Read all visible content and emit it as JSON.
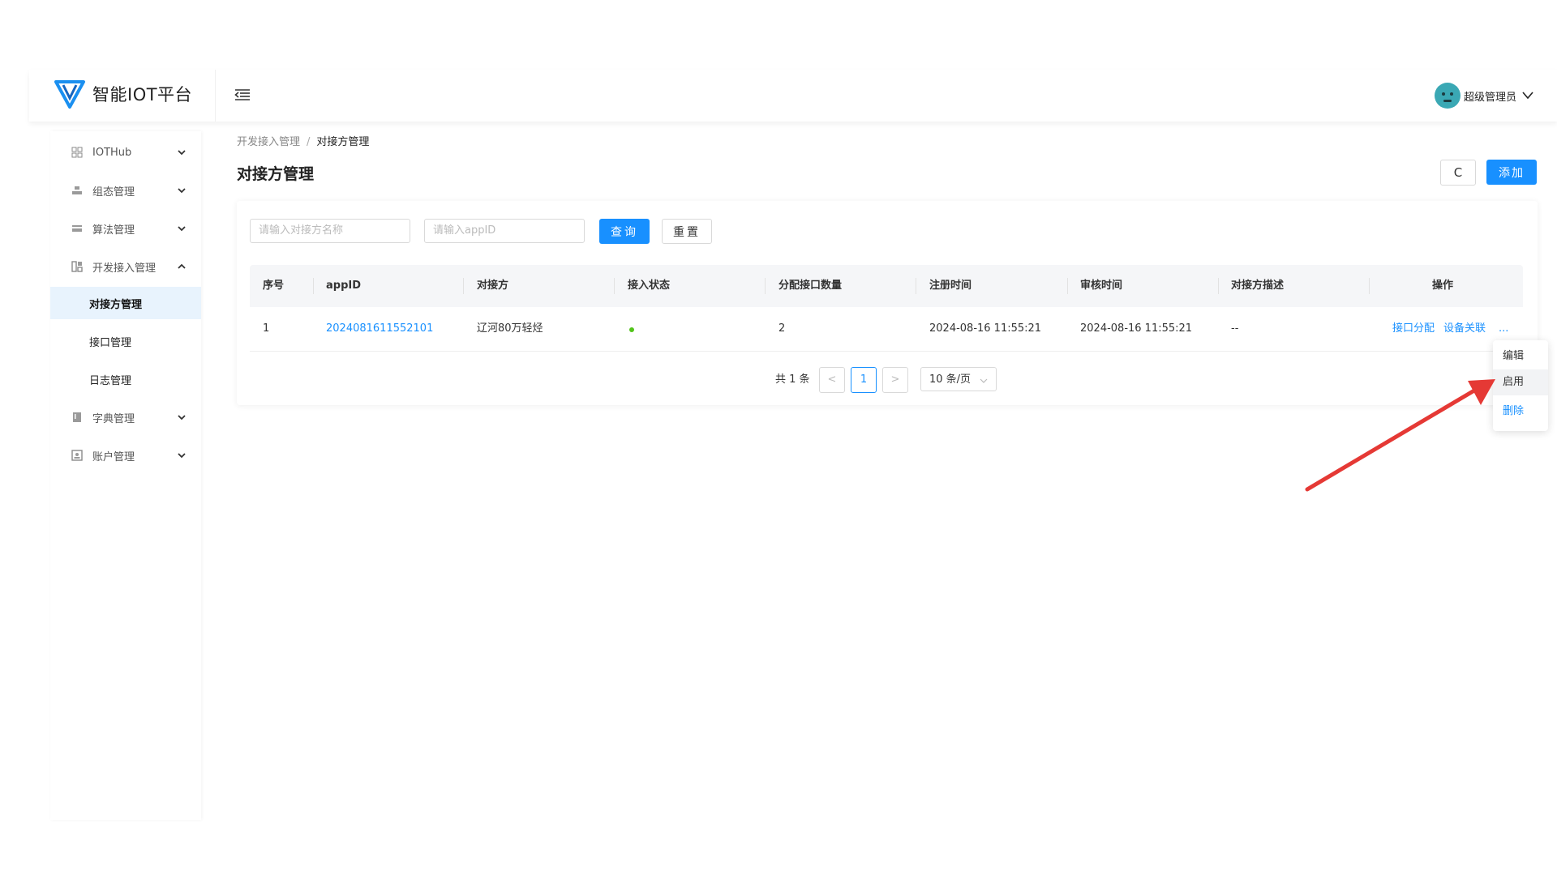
{
  "header": {
    "app_title": "智能IOT平台",
    "user_name": "超级管理员"
  },
  "sidebar": {
    "items": [
      {
        "label": "IOTHub",
        "icon": "grid-icon",
        "expanded": false
      },
      {
        "label": "组态管理",
        "icon": "layers-icon",
        "expanded": false
      },
      {
        "label": "算法管理",
        "icon": "card-icon",
        "expanded": false
      },
      {
        "label": "开发接入管理",
        "icon": "apps-icon",
        "expanded": true
      },
      {
        "label": "字典管理",
        "icon": "book-icon",
        "expanded": false
      },
      {
        "label": "账户管理",
        "icon": "account-icon",
        "expanded": false
      }
    ],
    "sub_items": [
      {
        "label": "对接方管理",
        "active": true
      },
      {
        "label": "接口管理",
        "active": false
      },
      {
        "label": "日志管理",
        "active": false
      }
    ]
  },
  "breadcrumb": {
    "parent": "开发接入管理",
    "separator": "/",
    "current": "对接方管理"
  },
  "page": {
    "title": "对接方管理",
    "refresh_label": "C",
    "add_label": "添加"
  },
  "search": {
    "name_placeholder": "请输入对接方名称",
    "appid_placeholder": "请输入appID",
    "query_label": "查询",
    "reset_label": "重置"
  },
  "table": {
    "columns": [
      "序号",
      "appID",
      "对接方",
      "接入状态",
      "分配接口数量",
      "注册时间",
      "审核时间",
      "对接方描述",
      "操作"
    ],
    "rows": [
      {
        "index": "1",
        "app_id": "2024081611552101",
        "partner": "辽河80万轻烃",
        "status": "online",
        "interface_count": "2",
        "register_time": "2024-08-16 11:55:21",
        "audit_time": "2024-08-16 11:55:21",
        "description": "--",
        "actions": [
          "接口分配",
          "设备关联",
          "..."
        ]
      }
    ]
  },
  "pagination": {
    "total": "共 1 条",
    "prev": "<",
    "current_page": "1",
    "next": ">",
    "page_size": "10 条/页"
  },
  "dropdown_menu": {
    "items": [
      "编辑",
      "启用",
      "删除"
    ]
  },
  "colors": {
    "primary": "#1890ff",
    "status_online": "#52c41a",
    "annotation_arrow": "#e53935"
  }
}
